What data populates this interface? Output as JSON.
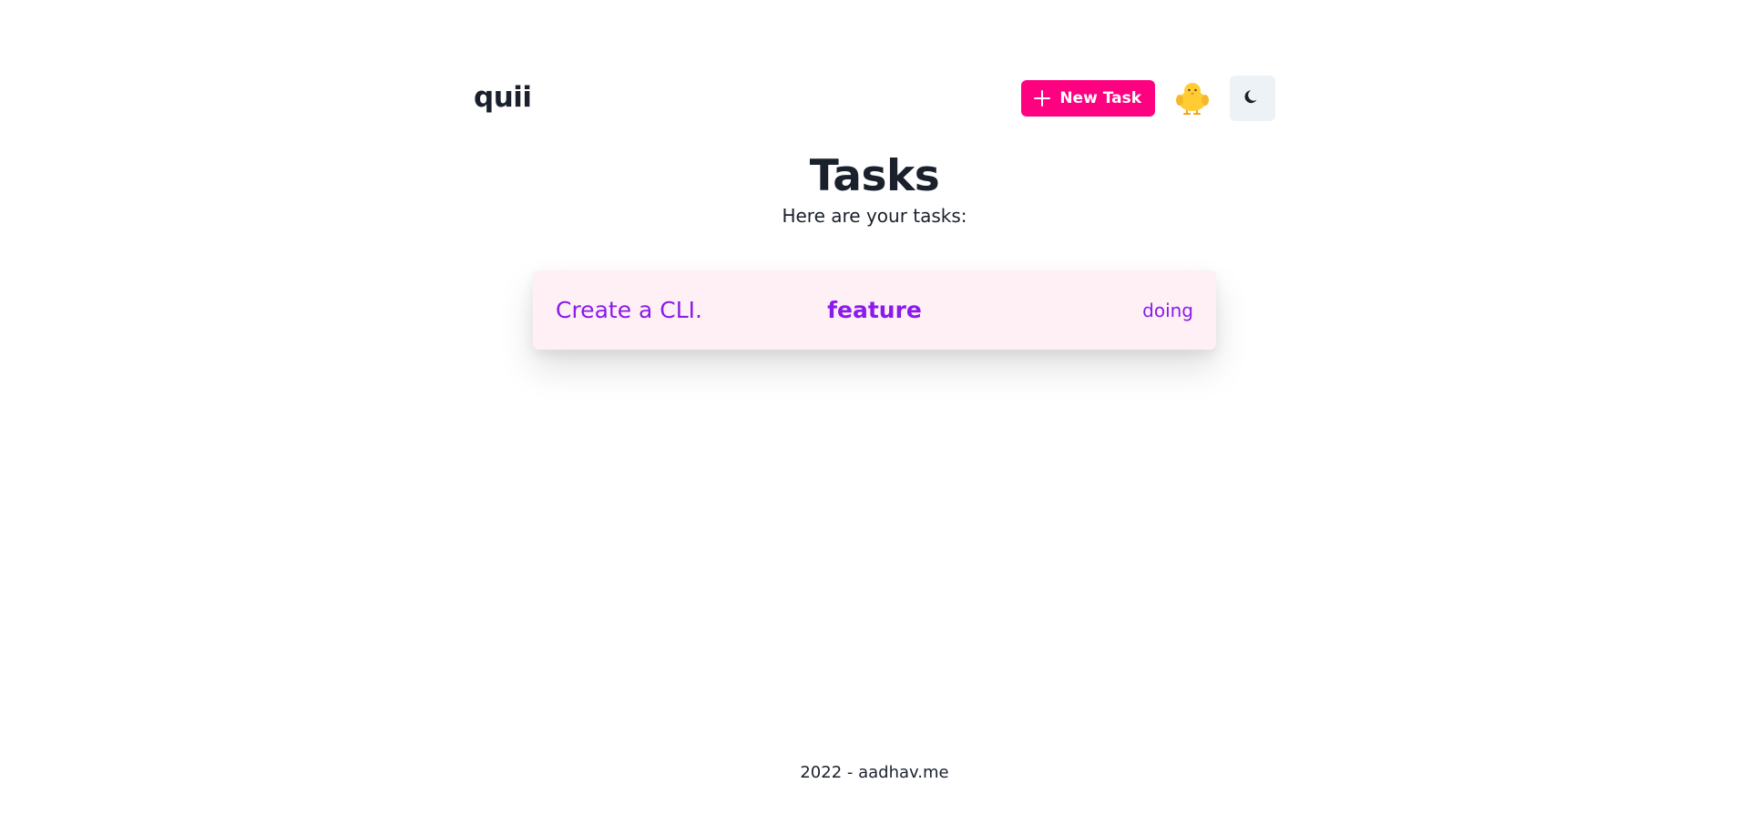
{
  "header": {
    "brand": "quii",
    "new_task_label": "New Task",
    "new_task_icon": "plus-icon",
    "mascot_icon": "chick-icon",
    "theme_toggle_icon": "moon-icon"
  },
  "main": {
    "title": "Tasks",
    "subtitle": "Here are your tasks:",
    "tasks": [
      {
        "name": "Create a CLI.",
        "type": "feature",
        "status": "doing"
      }
    ]
  },
  "footer": {
    "text": "2022 - aadhav.me"
  },
  "colors": {
    "accent": "#ff0080",
    "task_text": "#8a1bea",
    "task_bg": "#fff0f6",
    "text": "#1a202c",
    "toggle_bg": "#edf2f7"
  }
}
